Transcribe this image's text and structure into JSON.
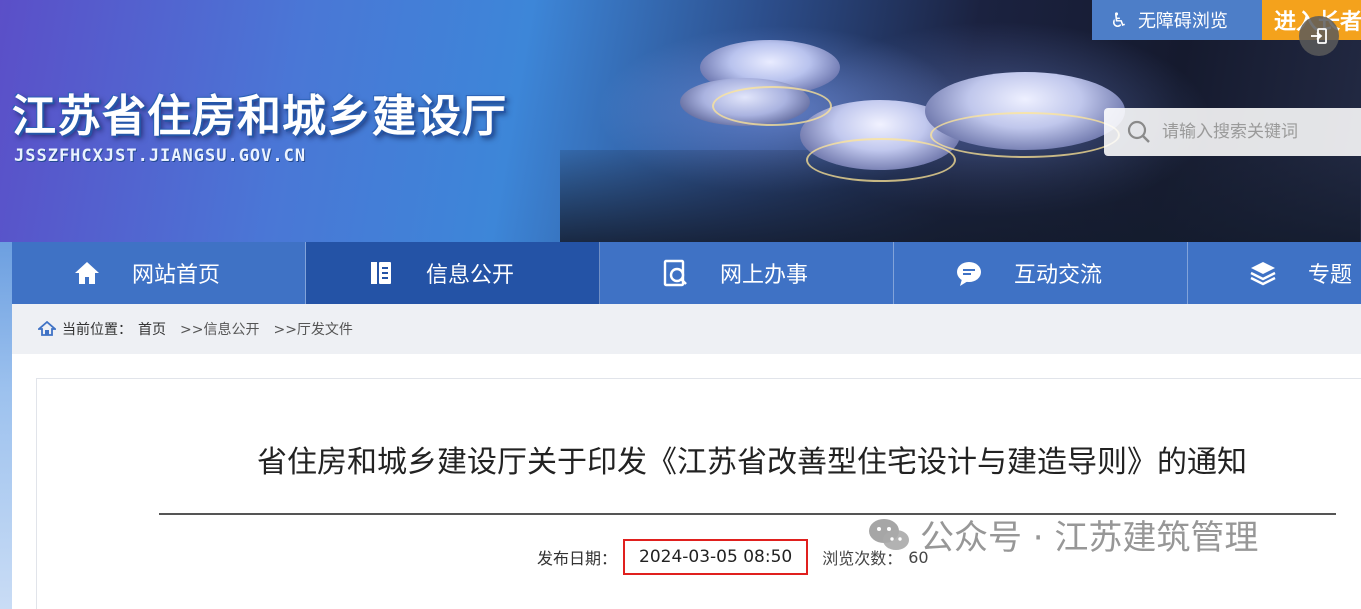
{
  "header": {
    "site_title": "江苏省住房和城乡建设厅",
    "site_domain": "JSSZFHCXJST.JIANGSU.GOV.CN",
    "accessibility_label": "无障碍浏览",
    "accessibility_icon": "wheelchair-icon",
    "enter_label": "进入长者",
    "search_placeholder": "请输入搜索关键词",
    "search_icon": "search-icon"
  },
  "nav": {
    "items": [
      {
        "label": "网站首页",
        "icon": "home-icon",
        "active": false
      },
      {
        "label": "信息公开",
        "icon": "document-icon",
        "active": true
      },
      {
        "label": "网上办事",
        "icon": "service-icon",
        "active": false
      },
      {
        "label": "互动交流",
        "icon": "chat-icon",
        "active": false
      },
      {
        "label": "专题",
        "icon": "layers-icon",
        "active": false
      }
    ]
  },
  "breadcrumb": {
    "prefix": "当前位置：",
    "items": [
      "首页",
      ">>信息公开",
      ">>厅发文件"
    ]
  },
  "article": {
    "title": "省住房和城乡建设厅关于印发《江苏省改善型住宅设计与建造导则》的通知",
    "date_label": "发布日期：",
    "date_value": "2024-03-05 08:50",
    "views_label": "浏览次数：",
    "views_value": "60"
  },
  "watermark": {
    "text": "公众号 · 江苏建筑管理"
  },
  "colors": {
    "nav_bg": "#3f72c5",
    "nav_active": "#2453a6",
    "accent_orange": "#f4a21c",
    "highlight_red": "#e0201e"
  }
}
